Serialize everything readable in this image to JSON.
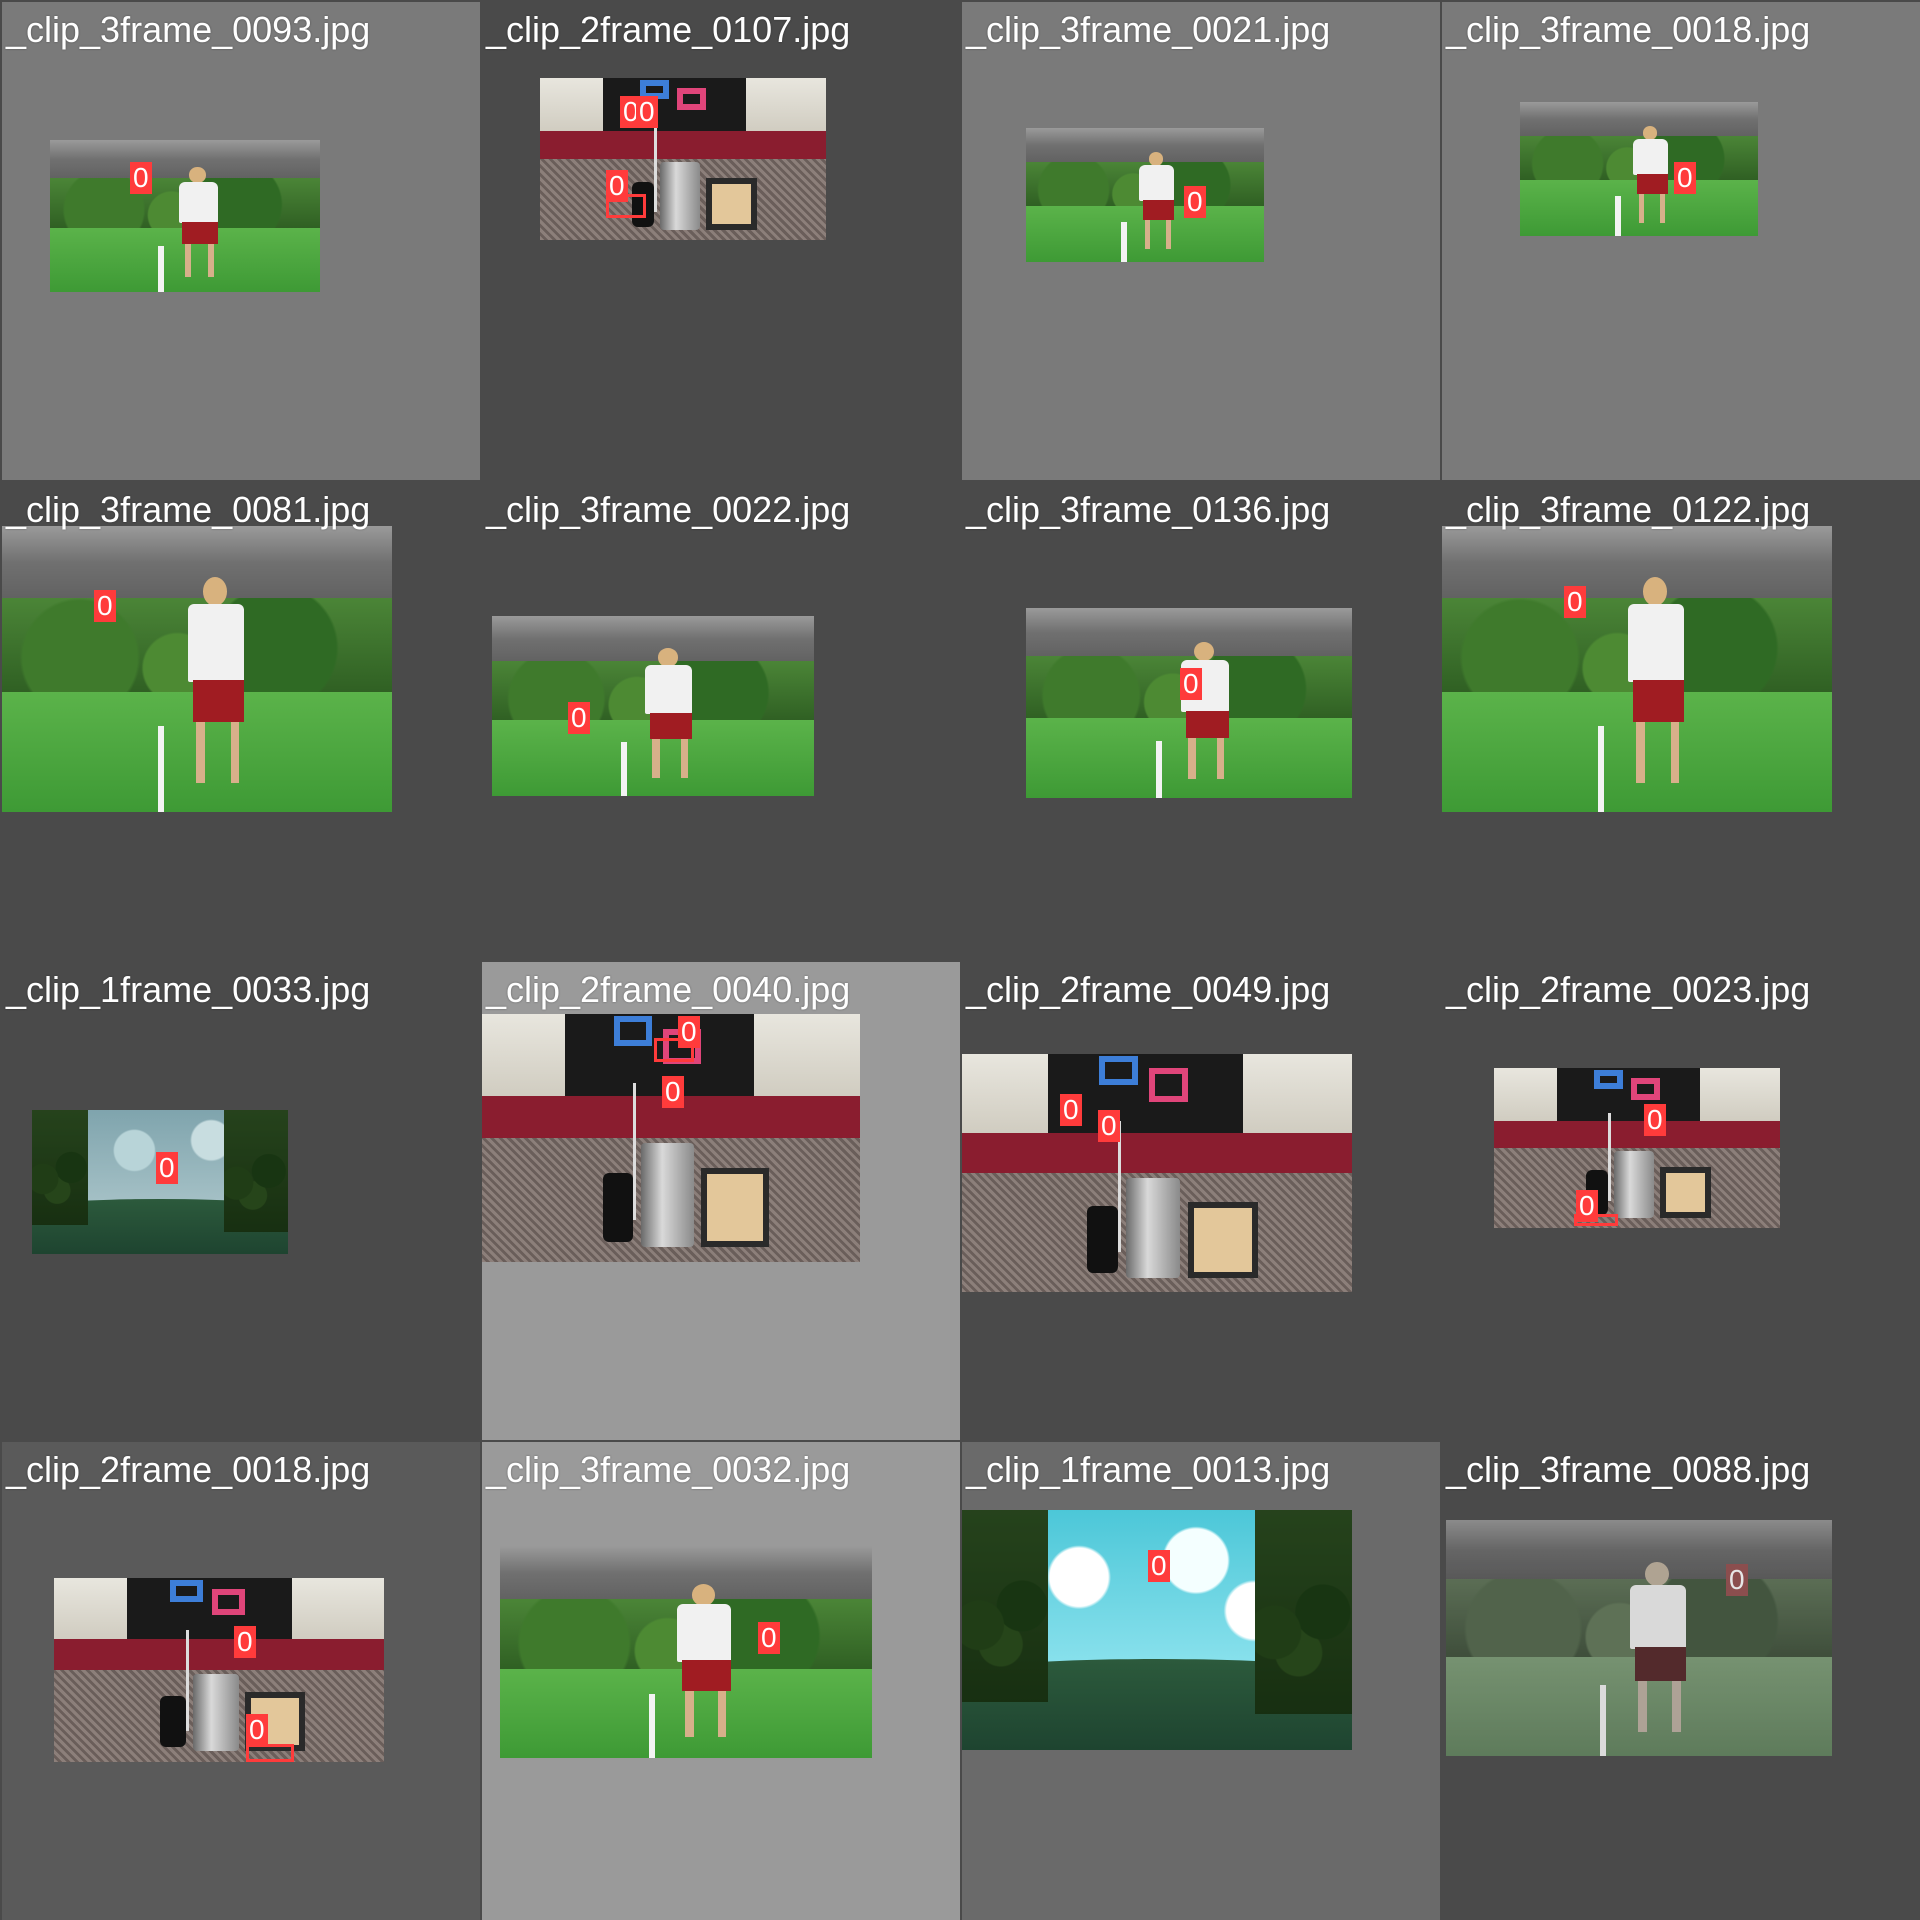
{
  "mosaic": {
    "label_color": "#ff3b3b",
    "label_text_color": "#ffffff",
    "cells": [
      {
        "title": "_clip_3frame_0093.jpg",
        "scene": "field",
        "bg": "#7a7a7a",
        "title_color": "#ffffff",
        "labels": [
          "0"
        ]
      },
      {
        "title": "_clip_2frame_0107.jpg",
        "scene": "indoor",
        "bg": "#4a4a4a",
        "title_color": "#ffffff",
        "labels": [
          "0",
          "0",
          "0"
        ]
      },
      {
        "title": "_clip_3frame_0021.jpg",
        "scene": "field",
        "bg": "#7a7a7a",
        "title_color": "#ffffff",
        "labels": [
          "0"
        ]
      },
      {
        "title": "_clip_3frame_0018.jpg",
        "scene": "field",
        "bg": "#7a7a7a",
        "title_color": "#ffffff",
        "labels": [
          "0"
        ]
      },
      {
        "title": "_clip_3frame_0081.jpg",
        "scene": "field",
        "bg": "#4a4a4a",
        "title_color": "#ffffff",
        "labels": [
          "0"
        ]
      },
      {
        "title": "_clip_3frame_0022.jpg",
        "scene": "field",
        "bg": "#4a4a4a",
        "title_color": "#ffffff",
        "labels": [
          "0"
        ]
      },
      {
        "title": "_clip_3frame_0136.jpg",
        "scene": "field",
        "bg": "#4a4a4a",
        "title_color": "#ffffff",
        "labels": [
          "0"
        ]
      },
      {
        "title": "_clip_3frame_0122.jpg",
        "scene": "field",
        "bg": "#4a4a4a",
        "title_color": "#ffffff",
        "labels": [
          "0"
        ]
      },
      {
        "title": "_clip_1frame_0033.jpg",
        "scene": "sky-dark",
        "bg": "#4a4a4a",
        "title_color": "#ffffff",
        "labels": [
          "0"
        ]
      },
      {
        "title": "_clip_2frame_0040.jpg",
        "scene": "indoor",
        "bg": "#9a9a9a",
        "title_color": "#ffffff",
        "labels": [
          "0",
          "0"
        ]
      },
      {
        "title": "_clip_2frame_0049.jpg",
        "scene": "indoor",
        "bg": "#4a4a4a",
        "title_color": "#ffffff",
        "labels": [
          "0",
          "0"
        ]
      },
      {
        "title": "_clip_2frame_0023.jpg",
        "scene": "indoor",
        "bg": "#4a4a4a",
        "title_color": "#ffffff",
        "labels": [
          "0",
          "0"
        ]
      },
      {
        "title": "_clip_2frame_0018.jpg",
        "scene": "indoor",
        "bg": "#5a5a5a",
        "title_color": "#ffffff",
        "labels": [
          "0",
          "0"
        ]
      },
      {
        "title": "_clip_3frame_0032.jpg",
        "scene": "field",
        "bg": "#9a9a9a",
        "title_color": "#ffffff",
        "labels": [
          "0"
        ]
      },
      {
        "title": "_clip_1frame_0013.jpg",
        "scene": "sky",
        "bg": "#6a6a6a",
        "title_color": "#ffffff",
        "labels": [
          "0"
        ]
      },
      {
        "title": "_clip_3frame_0088.jpg",
        "scene": "field-faded",
        "bg": "#4a4a4a",
        "title_color": "#ffffff",
        "labels": [
          "0"
        ]
      }
    ]
  }
}
